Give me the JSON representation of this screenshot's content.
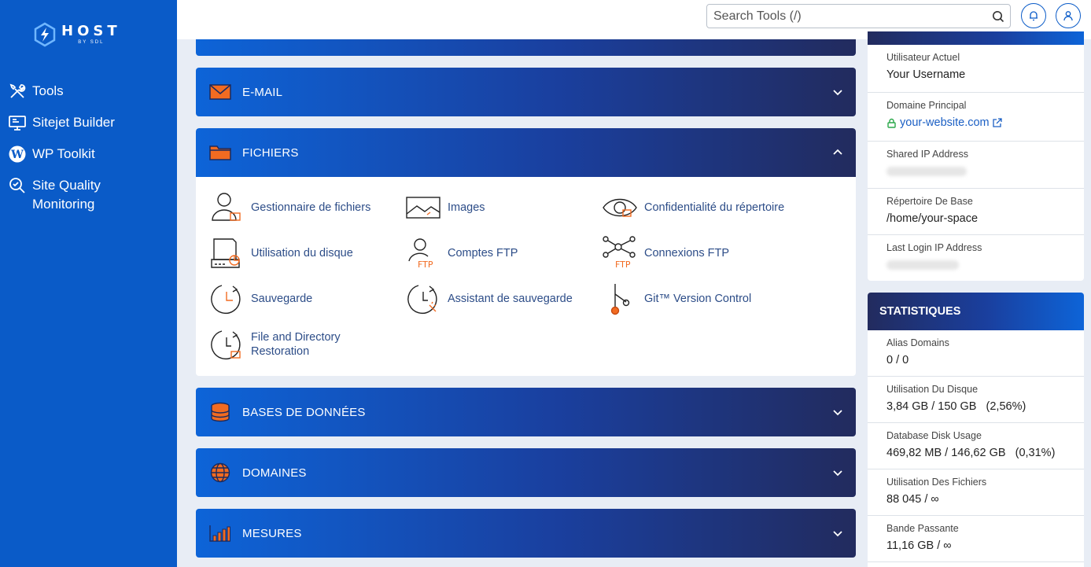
{
  "brand": {
    "name": "HOST",
    "sub": "BY SDL"
  },
  "sidebar": {
    "items": [
      {
        "label": "Tools",
        "icon": "tools-icon"
      },
      {
        "label": "Sitejet Builder",
        "icon": "monitor-icon"
      },
      {
        "label": "WP Toolkit",
        "icon": "wordpress-icon"
      },
      {
        "label": "Site Quality Monitoring",
        "icon": "magnifier-check-icon"
      }
    ]
  },
  "header": {
    "search_placeholder": "Search Tools (/)"
  },
  "panels": {
    "email": "E-MAIL",
    "files": "FICHIERS",
    "databases": "BASES DE DONNÉES",
    "domains": "DOMAINES",
    "metrics": "MESURES"
  },
  "files_tools": [
    {
      "label": "Gestionnaire de fichiers"
    },
    {
      "label": "Images"
    },
    {
      "label": "Confidentialité du répertoire"
    },
    {
      "label": "Utilisation du disque"
    },
    {
      "label": "Comptes FTP",
      "badge": "FTP"
    },
    {
      "label": "Connexions FTP",
      "badge": "FTP"
    },
    {
      "label": "Sauvegarde"
    },
    {
      "label": "Assistant de sauvegarde"
    },
    {
      "label": "Git™ Version Control"
    },
    {
      "label": "File and Directory Restoration"
    }
  ],
  "info": {
    "current_user_label": "Utilisateur Actuel",
    "current_user": "Your Username",
    "main_domain_label": "Domaine Principal",
    "main_domain": "your-website.com",
    "shared_ip_label": "Shared IP Address",
    "home_dir_label": "Répertoire De Base",
    "home_dir": "/home/your-space",
    "last_login_label": "Last Login IP Address"
  },
  "stats": {
    "title": "STATISTIQUES",
    "rows": [
      {
        "label": "Alias Domains",
        "value": "0 / 0"
      },
      {
        "label": "Utilisation Du Disque",
        "value": "3,84 GB / 150 GB   (2,56%)"
      },
      {
        "label": "Database Disk Usage",
        "value": "469,82 MB / 146,62 GB   (0,31%)"
      },
      {
        "label": "Utilisation Des Fichiers",
        "value": "88 045 / ∞"
      },
      {
        "label": "Bande Passante",
        "value": "11,16 GB / ∞"
      }
    ]
  },
  "colors": {
    "sidebar": "#0a5bc8",
    "accent_orange": "#f26b21",
    "link": "#1b5fc4"
  }
}
